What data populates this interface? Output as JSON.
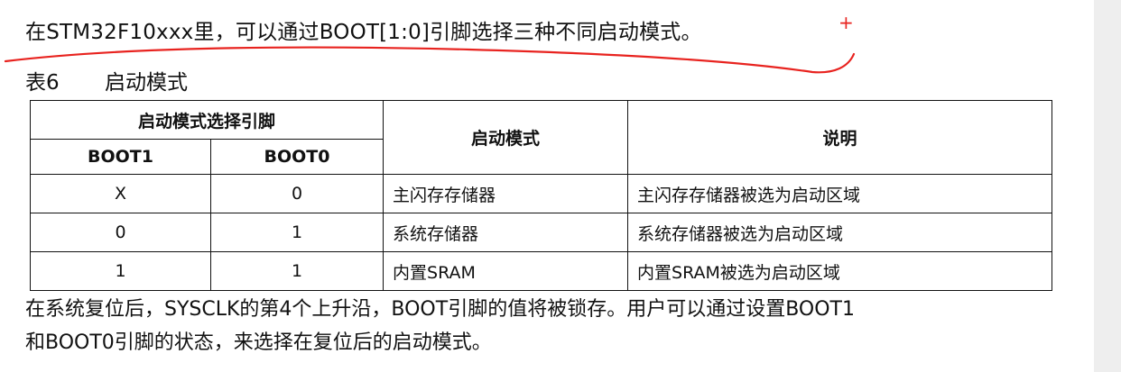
{
  "intro_text": "在STM32F10xxx里，可以通过BOOT[1:0]引脚选择三种不同启动模式。",
  "table_caption": {
    "number": "表6",
    "title": "启动模式"
  },
  "table": {
    "group_header": "启动模式选择引脚",
    "col_boot1": "BOOT1",
    "col_boot0": "BOOT0",
    "col_mode": "启动模式",
    "col_desc": "说明",
    "rows": [
      {
        "boot1": "X",
        "boot0": "0",
        "mode": "主闪存存储器",
        "desc": "主闪存存储器被选为启动区域"
      },
      {
        "boot1": "0",
        "boot0": "1",
        "mode": "系统存储器",
        "desc": "系统存储器被选为启动区域"
      },
      {
        "boot1": "1",
        "boot0": "1",
        "mode": "内置SRAM",
        "desc": "内置SRAM被选为启动区域"
      }
    ]
  },
  "outro_line1": "在系统复位后，SYSCLK的第4个上升沿，BOOT引脚的值将被锁存。用户可以通过设置BOOT1",
  "outro_line2": "和BOOT0引脚的状态，来选择在复位后的启动模式。",
  "annotation": {
    "mark": "+",
    "color": "#e8231f"
  }
}
